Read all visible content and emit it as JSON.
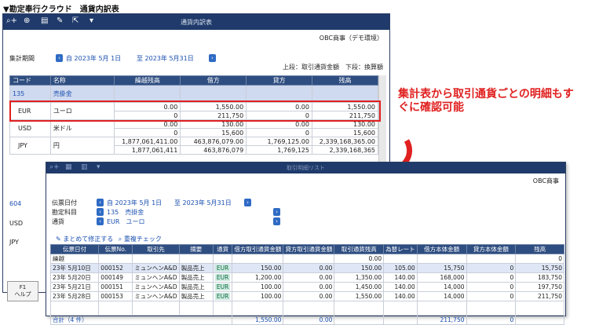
{
  "caption": "▼勘定奉行クラウド　通貨内訳表",
  "main": {
    "title": "通貨内訳表",
    "company": "OBC商事（デモ環境）",
    "period_label": "集計期間",
    "period_from": "自 2023年 5月 1日",
    "period_to": "至 2023年 5月31日",
    "upper_lower": "上段：取引通貨金額　下段：換算額",
    "columns": [
      "コード",
      "名称",
      "繰越残高",
      "借方",
      "貸方",
      "残高"
    ],
    "account_code": "135",
    "account_name": "売掛金",
    "rows": [
      {
        "code": "EUR",
        "name": "ユーロ",
        "r1": [
          "0.00",
          "1,550.00",
          "0.00",
          "1,550.00"
        ],
        "r2": [
          "0",
          "211,750",
          "0",
          "211,750"
        ]
      },
      {
        "code": "USD",
        "name": "米ドル",
        "r1": [
          "0.00",
          "130.00",
          "0.00",
          "130.00"
        ],
        "r2": [
          "0",
          "15,600",
          "0",
          "15,600"
        ]
      },
      {
        "code": "JPY",
        "name": "円",
        "r1": [
          "1,877,061,411.00",
          "463,876,079.00",
          "1,769,125.00",
          "2,339,168,365.00"
        ],
        "r2": [
          "1,877,061,411",
          "463,876,079",
          "1,769,125",
          "2,339,168,365"
        ]
      }
    ],
    "lower_codes": [
      "604",
      "USD",
      "JPY"
    ],
    "help_key": "F1",
    "help_label": "ヘルプ"
  },
  "callout": "集計表から取引通貨ごとの明細もすぐに確認可能",
  "sub": {
    "title": "取引明細リスト",
    "company": "OBC商事",
    "date_label": "伝票日付",
    "date_from": "自 2023年 5月 1日",
    "date_to": "至 2023年 5月31日",
    "account_label": "勘定科目",
    "account_value": "135　売掛金",
    "currency_label": "通貨",
    "currency_value": "EUR　ユーロ",
    "action1": "まとめて修正する",
    "action2": "重複チェック",
    "columns": [
      "伝票日付",
      "伝票No.",
      "取引先",
      "摘要",
      "通貨",
      "借方取引通貨金額",
      "貸方取引通貨金額",
      "取引通貨残高",
      "為替レート",
      "借方本体金額",
      "貸方本体金額",
      "残高"
    ],
    "carry": {
      "label": "繰越",
      "balance": "0.00",
      "amount": "0"
    },
    "rows": [
      {
        "date": "23年 5月10日",
        "no": "000152",
        "partner": "ミュンヘンA&D",
        "memo": "製品売上",
        "cur": "EUR",
        "debit": "150.00",
        "credit": "0.00",
        "bal": "150.00",
        "rate": "105.00",
        "dj": "15,750",
        "cj": "0",
        "total": "15,750"
      },
      {
        "date": "23年 5月20日",
        "no": "000149",
        "partner": "ミュンヘンA&D",
        "memo": "製品売上",
        "cur": "EUR",
        "debit": "1,200.00",
        "credit": "0.00",
        "bal": "1,350.00",
        "rate": "140.00",
        "dj": "168,000",
        "cj": "0",
        "total": "183,750"
      },
      {
        "date": "23年 5月21日",
        "no": "000151",
        "partner": "ミュンヘンA&D",
        "memo": "製品売上",
        "cur": "EUR",
        "debit": "100.00",
        "credit": "0.00",
        "bal": "1,450.00",
        "rate": "140.00",
        "dj": "14,000",
        "cj": "0",
        "total": "197,750"
      },
      {
        "date": "23年 5月28日",
        "no": "000153",
        "partner": "ミュンヘンA&D",
        "memo": "製品売上",
        "cur": "EUR",
        "debit": "100.00",
        "credit": "0.00",
        "bal": "1,550.00",
        "rate": "140.00",
        "dj": "14,000",
        "cj": "0",
        "total": "211,750"
      }
    ],
    "total": {
      "label": "合計（4 件）",
      "debit": "1,550.00",
      "credit": "0.00",
      "dj": "211,750",
      "cj": "0"
    }
  }
}
